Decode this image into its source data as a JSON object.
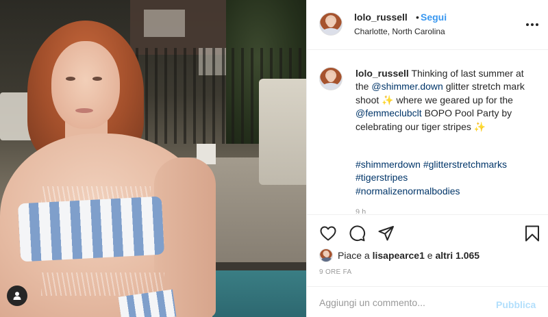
{
  "post": {
    "username": "lolo_russell",
    "dot": "•",
    "follow_label": "Segui",
    "location": "Charlotte, North Carolina",
    "more_icon": "more-horizontal-icon"
  },
  "caption": {
    "username": "lolo_russell",
    "t1": " Thinking of last summer at the ",
    "mention1": "@shimmer.down",
    "t2": " glitter stretch mark shoot ✨ where we geared up for the ",
    "mention2": "@femmeclubclt",
    "t3": " BOPO Pool Party by celebrating our tiger stripes ✨",
    "hashtags": [
      "#shimmerdown",
      "#glitterstretchmarks",
      "#tigerstripes",
      "#normalizenormalbodies"
    ],
    "time_partial": "9 h"
  },
  "actions": {
    "like": "heart-icon",
    "comment": "comment-icon",
    "share": "send-icon",
    "save": "bookmark-icon"
  },
  "likes": {
    "prefix": "Piace a ",
    "user": "lisapearce1",
    "middle": " e ",
    "others": "altri 1.065"
  },
  "timestamp": "9 ORE FA",
  "comment": {
    "placeholder": "Aggiungi un commento...",
    "publish_label": "Pubblica"
  },
  "photo": {
    "user_tag_icon": "user-tag-icon"
  },
  "colors": {
    "link_blue": "#3897f0",
    "hashtag_blue": "#003569",
    "publish_disabled": "#b2dffc",
    "muted": "#999999"
  }
}
